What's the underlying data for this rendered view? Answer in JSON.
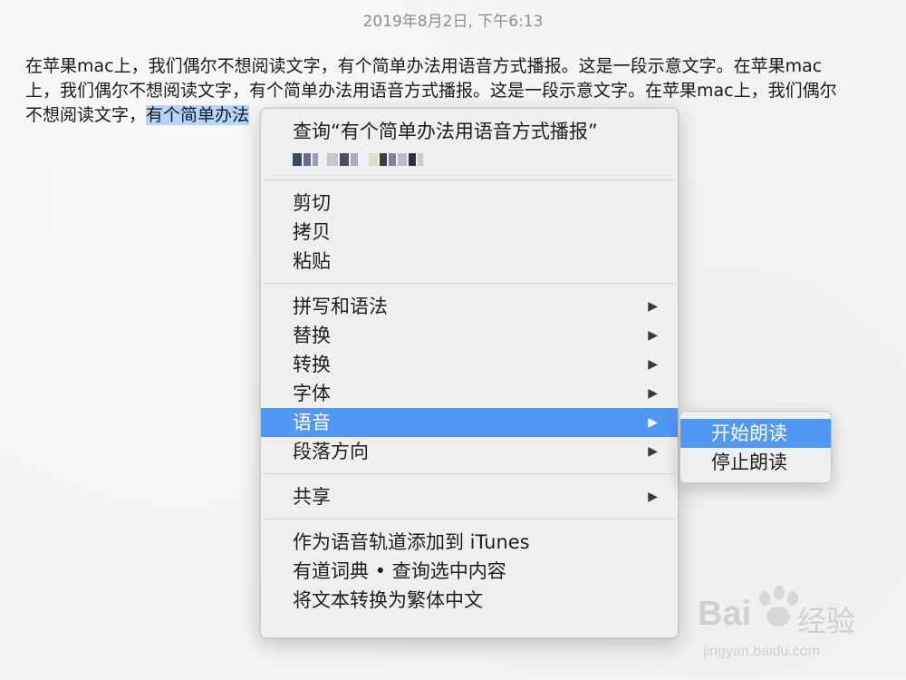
{
  "note": {
    "date": "2019年8月2日, 下午6:13",
    "lines": [
      "在苹果mac上，我们偶尔不想阅读文字，有个简单办法用语音方式播报。这是一段示意文字。在苹果mac",
      "上，我们偶尔不想阅读文字，有个简单办法用语音方式播报。这是一段示意文字。在苹果mac上，我们偶尔"
    ],
    "line3_prefix": "不想阅读文字，",
    "line3_selected": "有个简单办法"
  },
  "context_menu": {
    "lookup_label": "查询“有个简单办法用语音方式播报”",
    "group_edit": [
      "剪切",
      "拷贝",
      "粘贴"
    ],
    "group_format": [
      {
        "label": "拼写和语法",
        "has_submenu": true
      },
      {
        "label": "替换",
        "has_submenu": true
      },
      {
        "label": "转换",
        "has_submenu": true
      },
      {
        "label": "字体",
        "has_submenu": true
      },
      {
        "label": "语音",
        "has_submenu": true,
        "highlighted": true
      },
      {
        "label": "段落方向",
        "has_submenu": true
      }
    ],
    "share_label": "共享",
    "services": [
      "作为语音轨道添加到 iTunes",
      "有道词典 • 查询选中内容",
      "将文本转换为繁体中文"
    ],
    "submenu_arrow": "▶"
  },
  "speech_submenu": {
    "items": [
      "开始朗读",
      "停止朗读"
    ],
    "highlighted_index": 0
  },
  "watermark": {
    "brand": "Bai",
    "brand_suffix": "经验",
    "url": "jingyan.baidu.com"
  },
  "colors": {
    "highlight": "#5197f4",
    "selection": "#b4d5fe",
    "menu_bg": "#eeeeee"
  }
}
